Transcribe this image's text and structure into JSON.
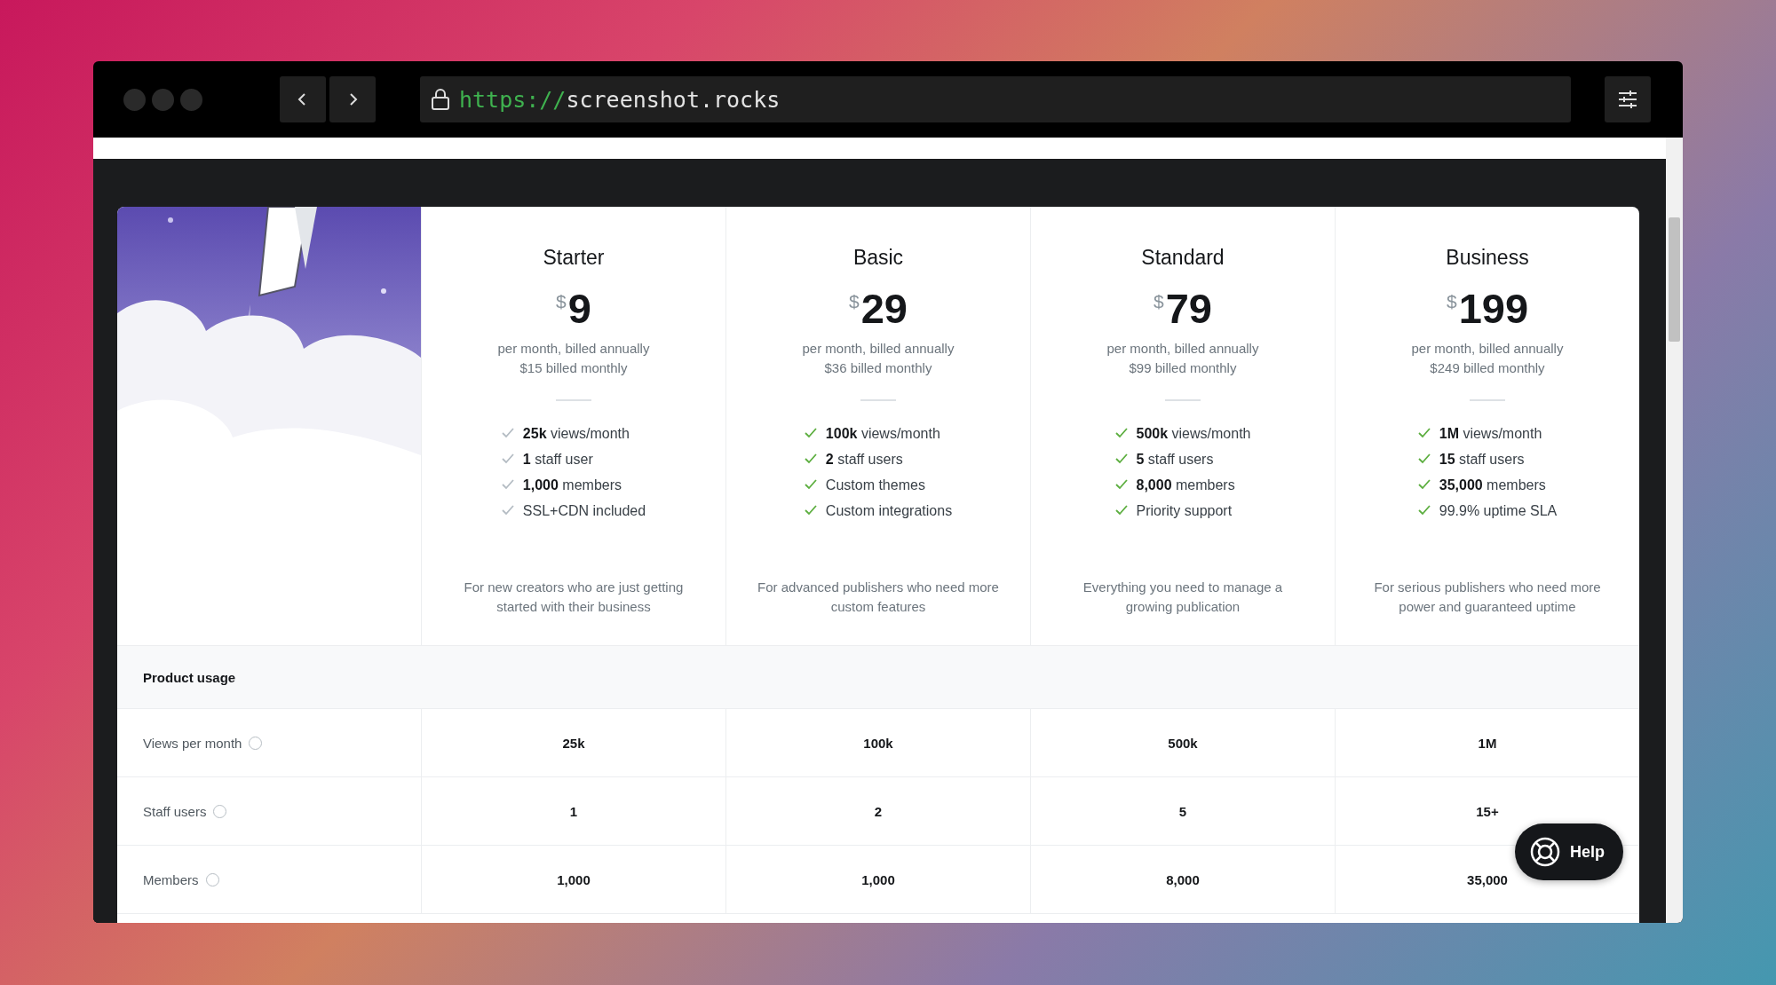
{
  "browser": {
    "url_scheme": "https://",
    "url_host": "screenshot.rocks"
  },
  "plans": [
    {
      "name": "Starter",
      "currency": "$",
      "price": "9",
      "billing": "per month, billed annually",
      "monthly": "$15 billed monthly",
      "color": "#b4bcc3",
      "features": [
        "**25k** views/month",
        "**1** staff user",
        "**1,000** members",
        "SSL+CDN included"
      ],
      "description": "For new creators who are just getting started with their business"
    },
    {
      "name": "Basic",
      "currency": "$",
      "price": "29",
      "billing": "per month, billed annually",
      "monthly": "$36 billed monthly",
      "color": "#5cae3f",
      "features": [
        "**100k** views/month",
        "**2** staff users",
        "Custom themes",
        "Custom integrations"
      ],
      "description": "For advanced publishers who need more custom features"
    },
    {
      "name": "Standard",
      "currency": "$",
      "price": "79",
      "billing": "per month, billed annually",
      "monthly": "$99 billed monthly",
      "color": "#5cae3f",
      "features": [
        "**500k** views/month",
        "**5** staff users",
        "**8,000** members",
        "Priority support"
      ],
      "description": "Everything you need to manage a growing publication"
    },
    {
      "name": "Business",
      "currency": "$",
      "price": "199",
      "billing": "per month, billed annually",
      "monthly": "$249 billed monthly",
      "color": "#5cae3f",
      "features": [
        "**1M** views/month",
        "**15** staff users",
        "**35,000** members",
        "99.9% uptime SLA"
      ],
      "description": "For serious publishers who need more power and guaranteed uptime"
    }
  ],
  "usage": {
    "title": "Product usage",
    "rows": [
      {
        "label": "Views per month",
        "values": [
          "25k",
          "100k",
          "500k",
          "1M"
        ]
      },
      {
        "label": "Staff users",
        "values": [
          "1",
          "2",
          "5",
          "15+"
        ]
      },
      {
        "label": "Members",
        "values": [
          "1,000",
          "1,000",
          "8,000",
          "35,000"
        ]
      }
    ]
  },
  "help": {
    "label": "Help"
  }
}
